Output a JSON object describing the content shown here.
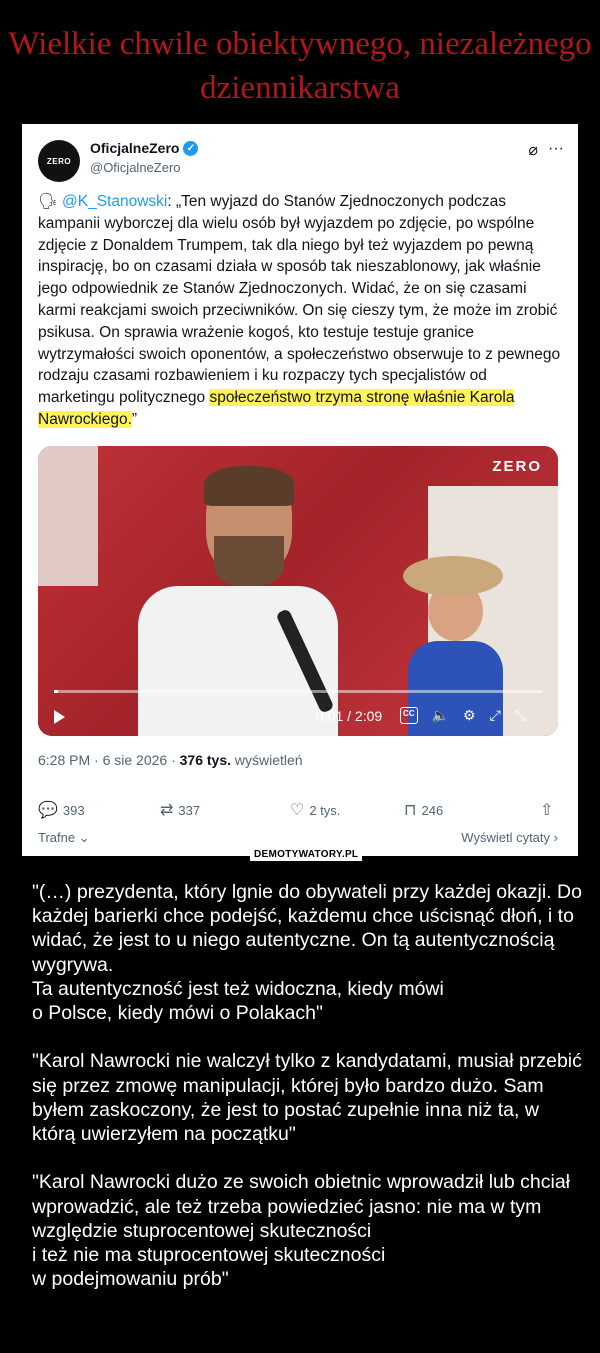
{
  "page_title": "Wielkie chwile obiektywnego, niezależnego dziennikarstwa",
  "tweet": {
    "display_name": "OficjalneZero",
    "handle": "@OficjalneZero",
    "avatar_text": "ZERO",
    "verified_icon": "✓",
    "speaker_icon": "🗣",
    "mention": "@K_Stanowski",
    "text_main": ": „Ten wyjazd do Stanów Zjednoczonych podczas kampanii wyborczej dla wielu osób był wyjazdem po zdjęcie, po wspólne zdjęcie z Donaldem Trumpem, tak dla niego był też wyjazdem po pewną inspirację, bo on czasami działa w sposób tak nieszablonowy, jak właśnie jego odpowiednik ze Stanów Zjednoczonych. Widać, że on się czasami karmi reakcjami swoich przeciwników. On się cieszy tym, że może im zrobić psikusa. On sprawia wrażenie kogoś, kto testuje testuje granice wytrzymałości swoich oponentów, a społeczeństwo obserwuje to z pewnego rodzaju czasami rozbawieniem i ku rozpaczy tych specjalistów od marketingu politycznego ",
    "text_highlight": "społeczeństwo trzyma stronę właśnie Karola Nawrockiego.",
    "text_end": "”",
    "video": {
      "logo": "ZERO",
      "time": "0:01 / 2:09",
      "progress": 0.008
    },
    "time": "6:28 PM · 6 sie 2026 · ",
    "views": "376 tys.",
    "views_label": " wyświetleń",
    "replies": "393",
    "retweets": "337",
    "likes": "2 tys.",
    "bookmarks": "246",
    "sort_label": "Trafne",
    "quotes_label": "Wyświetl cytaty"
  },
  "watermark": "DEMOTYWATORY.PL",
  "caption": "\"(…) prezydenta, który lgnie do obywateli przy każdej okazji. Do każdej barierki chce podejść, każdemu chce uścisnąć dłoń, i to widać, że jest to u niego autentyczne. On tą autentycznością wygrywa.\nTa autentyczność jest też widoczna, kiedy mówi\no Polsce, kiedy mówi o Polakach\"\n\n\"Karol Nawrocki nie walczył tylko z kandydatami, musiał przebić się przez zmowę manipulacji, której było bardzo dużo. Sam byłem zaskoczony, że jest to postać zupełnie inna niż ta, w którą uwierzyłem na początku\"\n\n\"Karol Nawrocki dużo ze swoich obietnic wprowadził lub chciał wprowadzić, ale też trzeba powiedzieć jasno: nie ma w tym względzie stuprocentowej skuteczności\ni też nie ma stuprocentowej skuteczności\nw podejmowaniu prób\""
}
